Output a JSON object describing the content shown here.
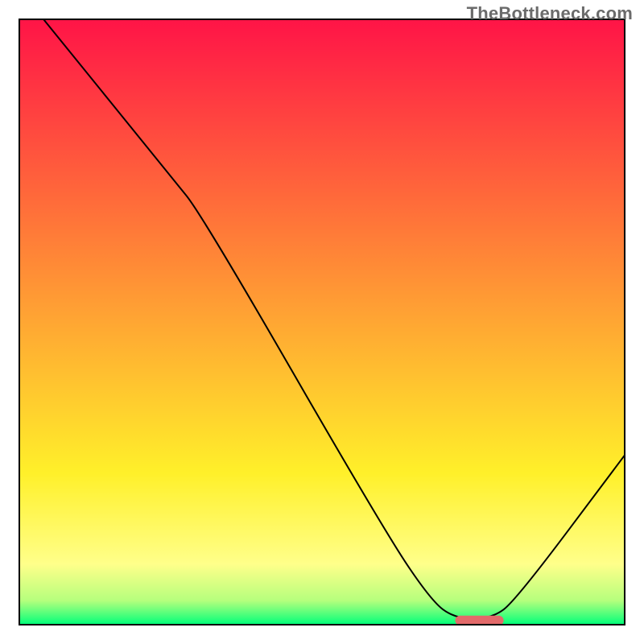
{
  "watermark": "TheBottleneck.com",
  "chart_data": {
    "type": "line",
    "title": "",
    "xlabel": "",
    "ylabel": "",
    "axes_visible": false,
    "xlim": [
      0,
      100
    ],
    "ylim": [
      0,
      100
    ],
    "background_gradient": {
      "stops": [
        {
          "offset": 0,
          "color": "#ff1447"
        },
        {
          "offset": 30,
          "color": "#ff6b3a"
        },
        {
          "offset": 55,
          "color": "#ffb531"
        },
        {
          "offset": 75,
          "color": "#fff02a"
        },
        {
          "offset": 90,
          "color": "#ffff8a"
        },
        {
          "offset": 96,
          "color": "#b6ff7d"
        },
        {
          "offset": 100,
          "color": "#00ff7a"
        }
      ]
    },
    "curve": {
      "name": "bottleneck-curve",
      "color": "#000000",
      "width": 2,
      "points": [
        {
          "x": 4,
          "y": 100
        },
        {
          "x": 25,
          "y": 74
        },
        {
          "x": 30,
          "y": 68
        },
        {
          "x": 60,
          "y": 16
        },
        {
          "x": 68,
          "y": 4
        },
        {
          "x": 72,
          "y": 1
        },
        {
          "x": 78,
          "y": 1
        },
        {
          "x": 82,
          "y": 4
        },
        {
          "x": 100,
          "y": 28
        }
      ]
    },
    "marker": {
      "name": "sweet-spot-marker",
      "color": "#e26a6a",
      "x_start": 72,
      "x_end": 80,
      "y": 0.7
    },
    "frame": {
      "x": 3,
      "y": 3,
      "width": 94,
      "height": 94,
      "stroke": "#000000",
      "stroke_width": 2
    }
  }
}
